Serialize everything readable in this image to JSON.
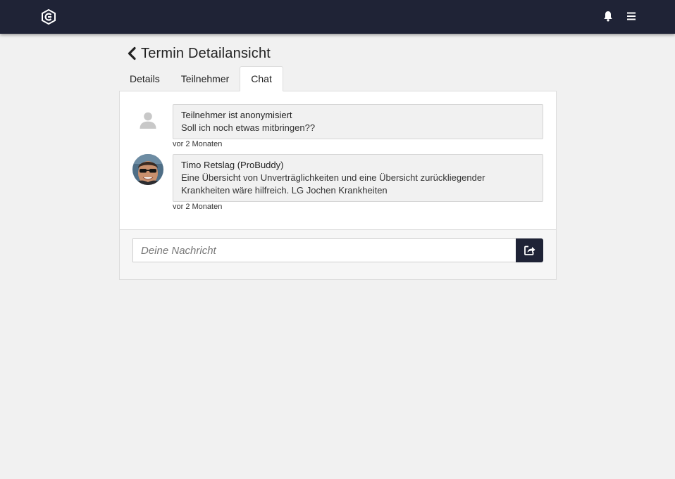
{
  "header": {
    "logo_icon": "brand-logo-icon",
    "bell_icon": "bell-icon",
    "menu_icon": "hamburger-menu-icon",
    "background_color": "#1f2336"
  },
  "page": {
    "title": "Termin Detailansicht",
    "back_icon": "chevron-left-icon"
  },
  "tabs": [
    {
      "label": "Details",
      "active": false
    },
    {
      "label": "Teilnehmer",
      "active": false
    },
    {
      "label": "Chat",
      "active": true
    }
  ],
  "chat": {
    "messages": [
      {
        "author": "Teilnehmer ist anonymisiert",
        "text": "Soll ich noch etwas mitbringen??",
        "time": "vor 2 Monaten",
        "avatar": "default-user-icon"
      },
      {
        "author": "Timo Retslag (ProBuddy)",
        "text": "Eine Übersicht von Unverträglichkeiten und eine Übersicht zurückliegender Krankheiten wäre hilfreich. LG Jochen Krankheiten",
        "time": "vor 2 Monaten",
        "avatar": "user-photo"
      }
    ],
    "input": {
      "placeholder": "Deine Nachricht",
      "value": ""
    },
    "send_icon": "share-send-icon"
  }
}
